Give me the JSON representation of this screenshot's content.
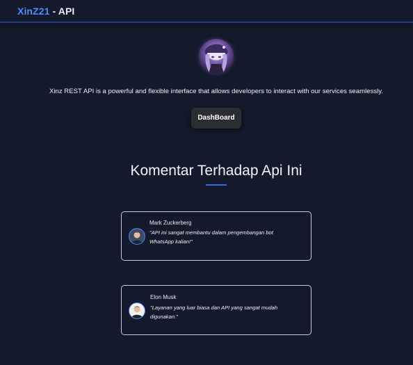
{
  "header": {
    "brand_accent": "XinZ21",
    "brand_rest": " - API"
  },
  "profile": {
    "avatar_icon": "anime-profile-avatar",
    "description": "Xinz REST API is a powerful and flexible interface that allows developers to interact with our services seamlessly."
  },
  "actions": {
    "dashboard_label": "DashBoard"
  },
  "comments": {
    "title": "Komentar Terhadap Api Ini",
    "items": [
      {
        "name": "Mark Zuckerberg",
        "quote": "\"API ini sangat membantu dalam pengembangan bot WhatsApp kalian!\"",
        "avatar_icon": "person-avatar"
      },
      {
        "name": "Elon Musk",
        "quote": "\"Layanan yang luar biasa dan API yang sangat mudah digunakan.\"",
        "avatar_icon": "person-avatar"
      }
    ]
  },
  "colors": {
    "background": "#141a2b",
    "accent": "#4f8cff",
    "header_border": "#1f3f86",
    "button_bg": "#2b2d33",
    "card_border": "#c9ced9"
  }
}
